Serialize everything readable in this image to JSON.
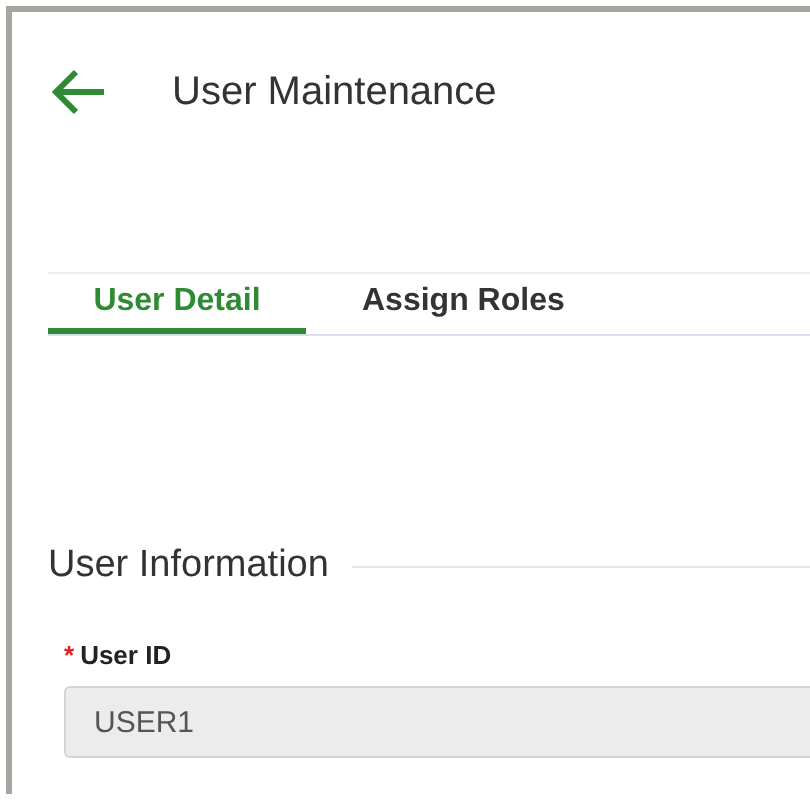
{
  "header": {
    "title": "User Maintenance"
  },
  "tabs": [
    {
      "label": "User Detail",
      "selected": true
    },
    {
      "label": "Assign Roles",
      "selected": false
    }
  ],
  "section": {
    "title": "User Information"
  },
  "fields": [
    {
      "label": "User ID",
      "required_mark": "*",
      "value": "USER1",
      "disabled": true
    }
  ]
}
